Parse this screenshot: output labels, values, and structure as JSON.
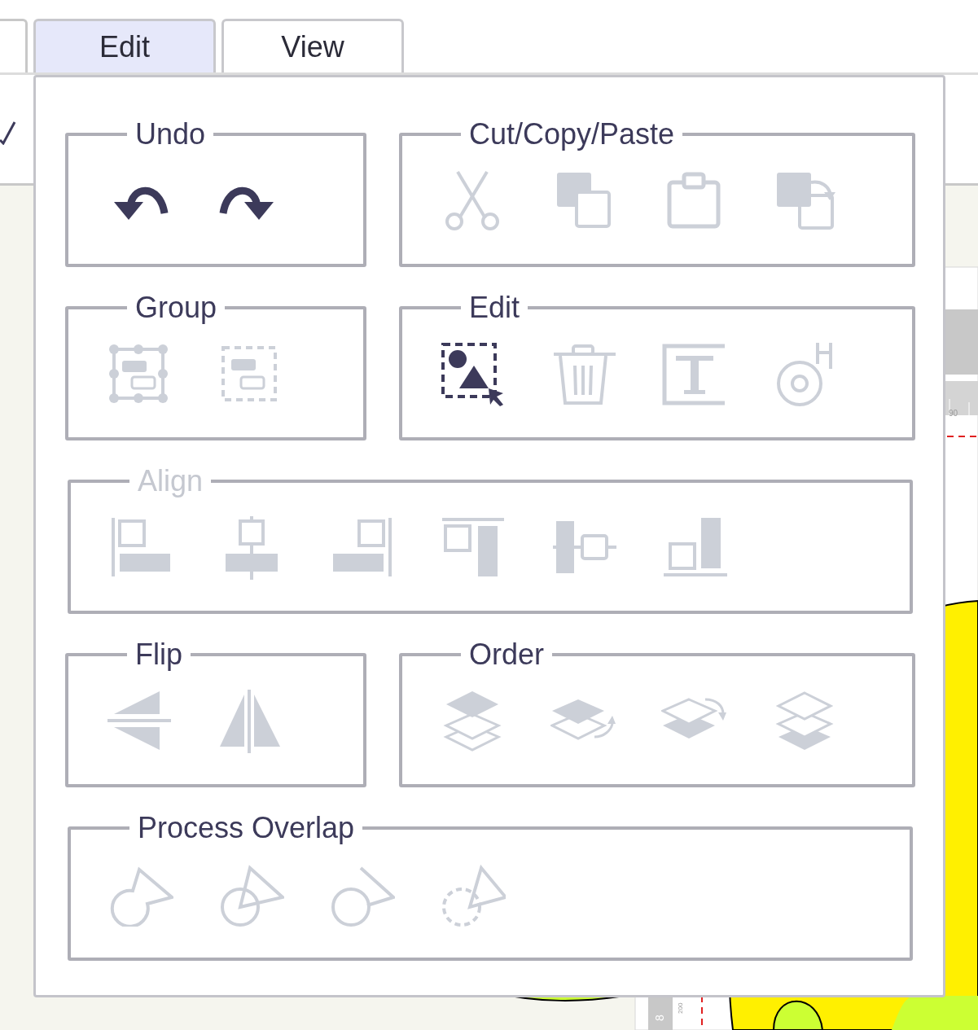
{
  "tabs": [
    {
      "label": "Edit",
      "selected": true
    },
    {
      "label": "View",
      "selected": false
    }
  ],
  "rows": [
    [
      {
        "title": "Undo",
        "disabled": false,
        "tools": [
          {
            "kind": "undo",
            "enabled": true
          },
          {
            "kind": "redo",
            "enabled": true
          }
        ]
      },
      {
        "title": "Cut/Copy/Paste",
        "disabled": false,
        "tools": [
          {
            "kind": "cut",
            "enabled": false
          },
          {
            "kind": "copy",
            "enabled": false
          },
          {
            "kind": "paste",
            "enabled": false
          },
          {
            "kind": "paste-special",
            "enabled": false
          }
        ]
      }
    ],
    [
      {
        "title": "Group",
        "disabled": false,
        "tools": [
          {
            "kind": "group",
            "enabled": false
          },
          {
            "kind": "ungroup",
            "enabled": false
          }
        ]
      },
      {
        "title": "Edit",
        "disabled": false,
        "tools": [
          {
            "kind": "select",
            "enabled": true
          },
          {
            "kind": "delete",
            "enabled": false
          },
          {
            "kind": "text",
            "enabled": false
          },
          {
            "kind": "target",
            "enabled": false
          }
        ]
      }
    ],
    [
      {
        "title": "Align",
        "disabled": true,
        "tools": [
          {
            "kind": "align-left",
            "enabled": false
          },
          {
            "kind": "align-center",
            "enabled": false
          },
          {
            "kind": "align-right",
            "enabled": false
          },
          {
            "kind": "align-top",
            "enabled": false
          },
          {
            "kind": "align-middle",
            "enabled": false
          },
          {
            "kind": "align-bottom",
            "enabled": false
          }
        ]
      }
    ],
    [
      {
        "title": "Flip",
        "disabled": false,
        "tools": [
          {
            "kind": "flip-vertical",
            "enabled": false
          },
          {
            "kind": "flip-horizontal",
            "enabled": false
          }
        ]
      },
      {
        "title": "Order",
        "disabled": false,
        "tools": [
          {
            "kind": "bring-front",
            "enabled": false
          },
          {
            "kind": "forward",
            "enabled": false
          },
          {
            "kind": "backward",
            "enabled": false
          },
          {
            "kind": "send-back",
            "enabled": false
          }
        ]
      }
    ],
    [
      {
        "title": "Process Overlap",
        "disabled": false,
        "tools": [
          {
            "kind": "overlap-union",
            "enabled": false
          },
          {
            "kind": "overlap-split",
            "enabled": false
          },
          {
            "kind": "overlap-join",
            "enabled": false
          },
          {
            "kind": "overlap-subtract",
            "enabled": false
          }
        ]
      }
    ]
  ],
  "rulers": {
    "horizontal_label": "90",
    "vertical_label": "8",
    "vertical_label_2": "200"
  }
}
